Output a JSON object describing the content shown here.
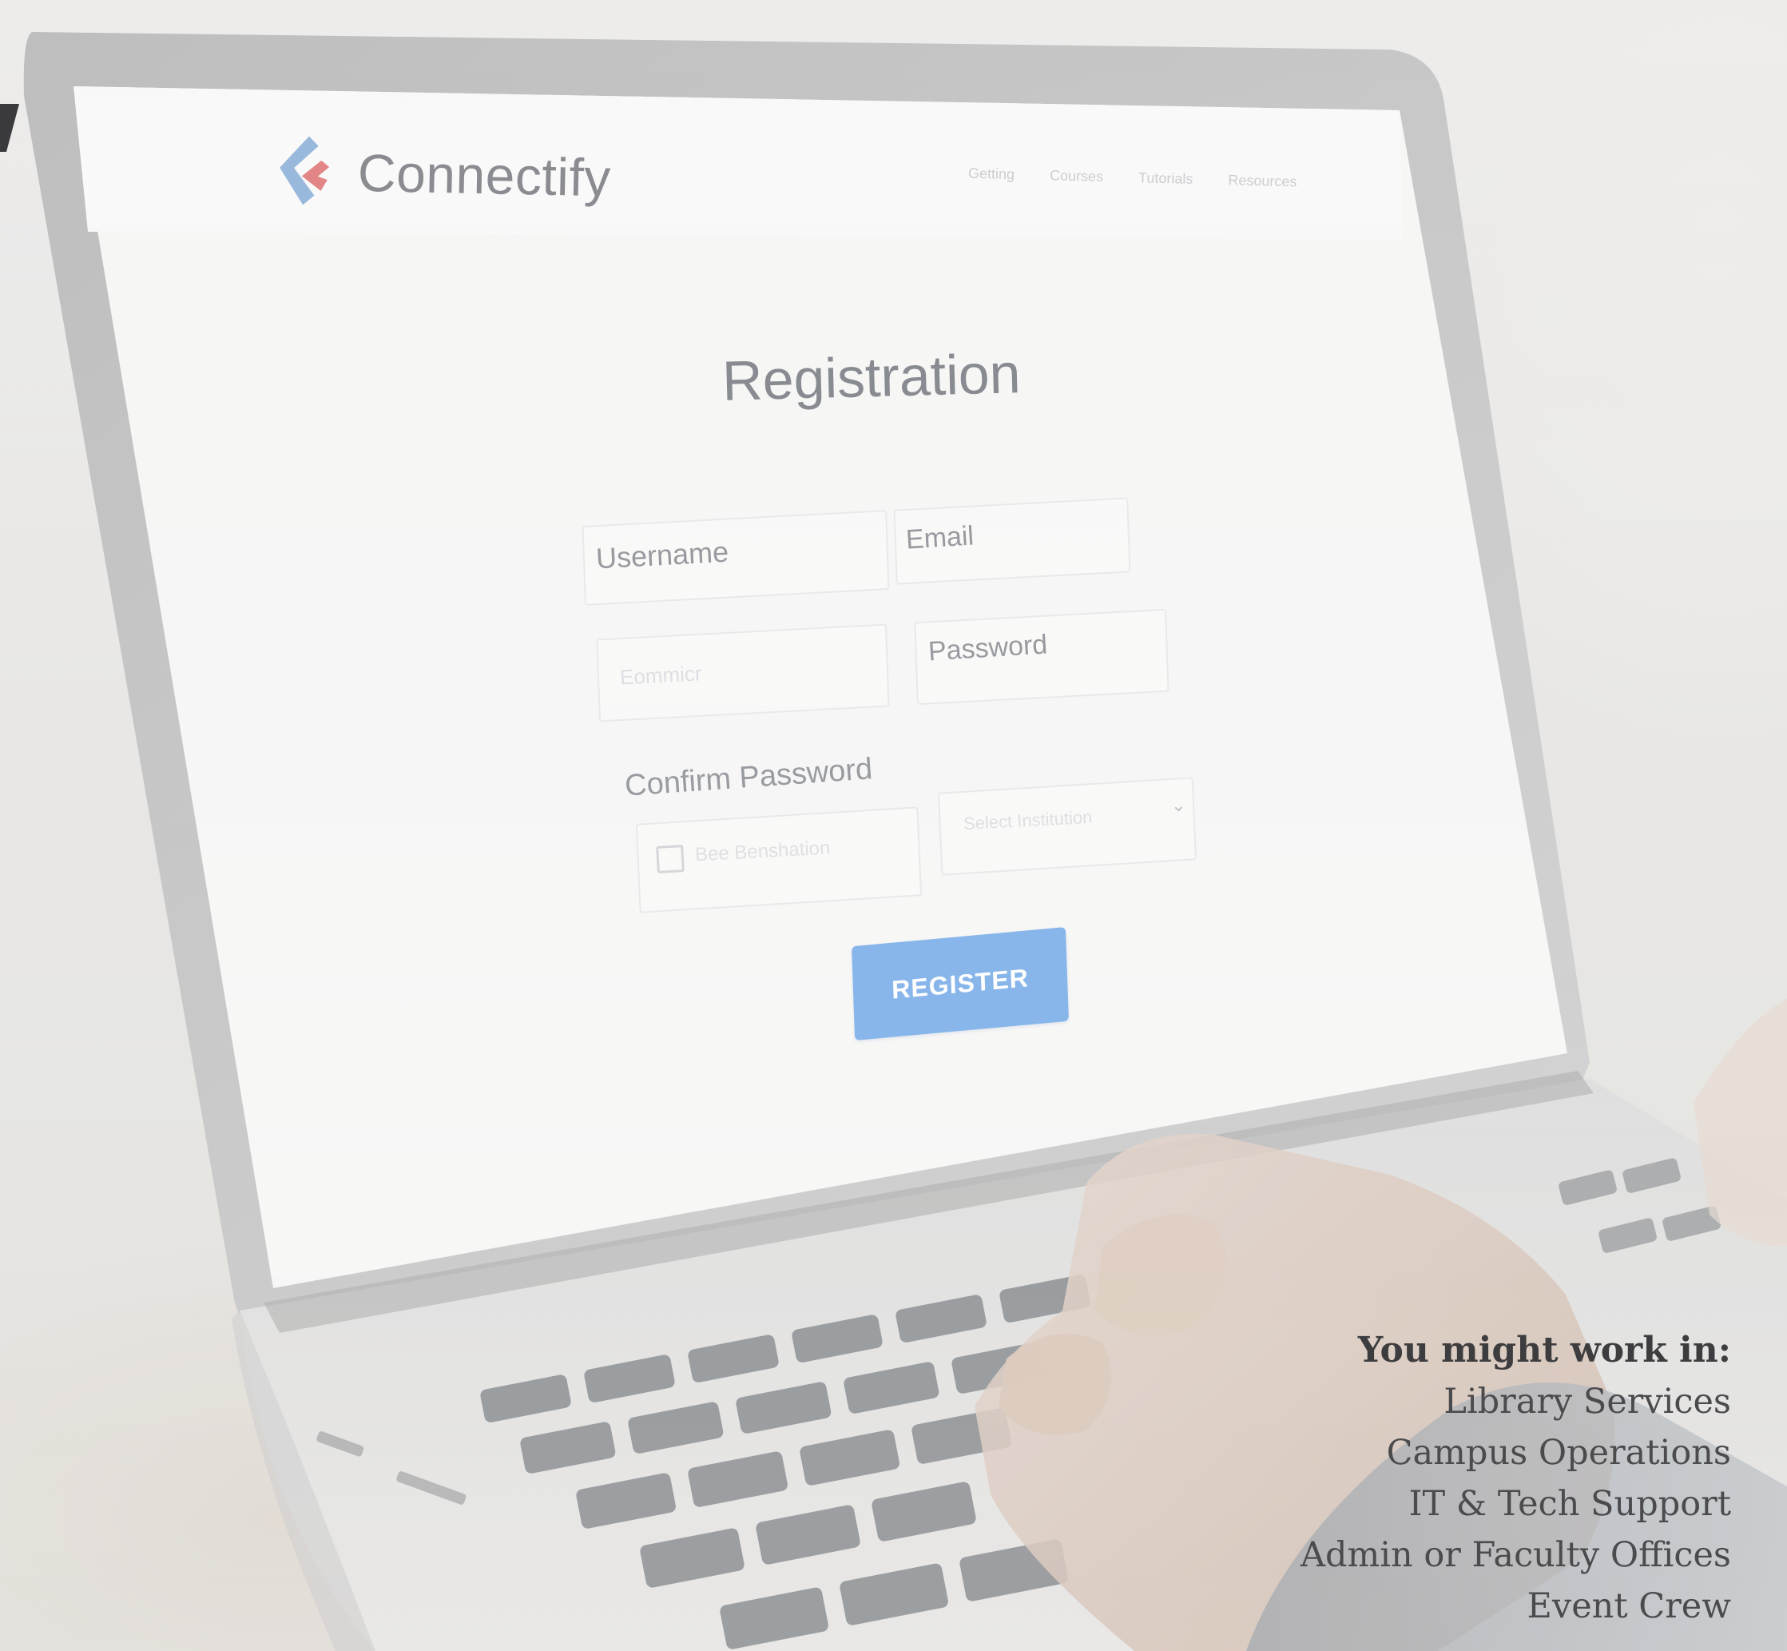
{
  "screen": {
    "brand": "Connectify",
    "nav_links": [
      "Getting",
      "Courses",
      "Tutorials",
      "Resources"
    ],
    "title": "Registration",
    "fields": {
      "username": "Username",
      "email": "Email",
      "faint_left": "Eommicr",
      "password": "Password",
      "confirm_password": "Confirm Password",
      "checkbox_label": "Bee Benshation",
      "select_placeholder": "Select Institution"
    },
    "register_button": "REGISTER"
  },
  "caption": {
    "heading": "You might work in:",
    "items": [
      "Library Services",
      "Campus Operations",
      "IT & Tech Support",
      "Admin or Faculty Offices",
      "Event Crew"
    ]
  },
  "colors": {
    "register_button": "#7aaee8",
    "logo_blue": "#8fb3d9",
    "logo_red": "#e07a7a"
  }
}
